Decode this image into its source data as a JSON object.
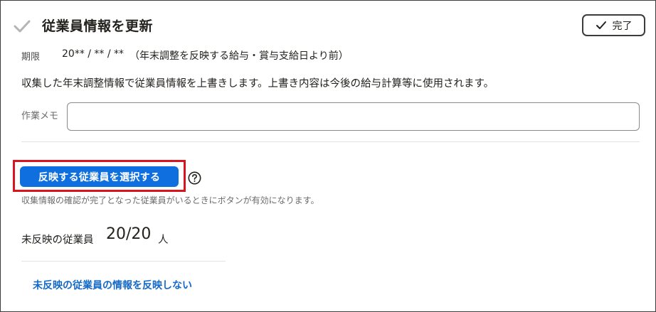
{
  "header": {
    "title": "従業員情報を更新",
    "done_label": "完了",
    "check_icon": "checkmark-icon"
  },
  "period": {
    "label": "期限",
    "value": "20** / ** / **",
    "note": "（年末調整を反映する給与・賞与支給日より前）"
  },
  "description": "収集した年末調整情報で従業員情報を上書きします。上書き内容は今後の給与計算等に使用されます。",
  "memo": {
    "label": "作業メモ",
    "value": "",
    "placeholder": ""
  },
  "reflect": {
    "button_label": "反映する従業員を選択する",
    "help_icon": "question-circle-icon",
    "hint": "収集情報の確認が完了となった従業員がいるときにボタンが有効になります。"
  },
  "unreflected": {
    "label": "未反映の従業員",
    "count": "20/20",
    "unit": "人"
  },
  "link": {
    "no_reflect_label": "未反映の従業員の情報を反映しない"
  },
  "colors": {
    "primary": "#0f6fde",
    "link": "#1569c7",
    "highlight": "#d8141f",
    "text": "#23221e"
  }
}
